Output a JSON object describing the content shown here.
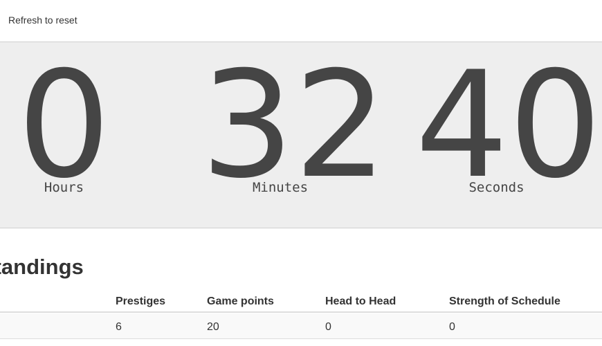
{
  "header": {
    "reset_label": "Refresh to reset"
  },
  "timer": {
    "hours": {
      "value": "0",
      "label": "Hours"
    },
    "minutes": {
      "value": "32",
      "label": "Minutes"
    },
    "seconds": {
      "value": "40",
      "label": "Seconds"
    }
  },
  "standings": {
    "title_visible": "t Standings",
    "columns": [
      "Prestiges",
      "Game points",
      "Head to Head",
      "Strength of Schedule"
    ],
    "rows": [
      [
        "6",
        "20",
        "0",
        "0"
      ]
    ]
  },
  "colors": {
    "panel_background": "#eeeeee",
    "digit_color": "#454545",
    "text": "#333333",
    "row_stripe": "#f9f9f9"
  }
}
